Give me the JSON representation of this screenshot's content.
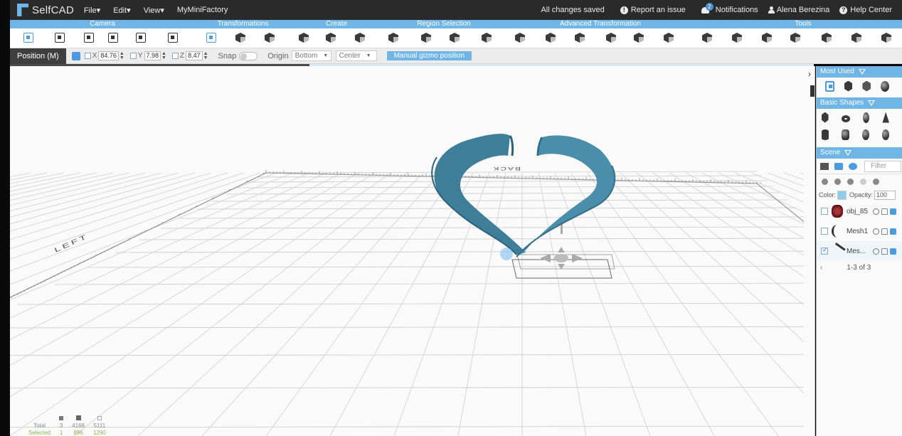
{
  "topbar": {
    "logo_text": "SelfCAD",
    "menus": [
      "File",
      "Edit",
      "View"
    ],
    "menu_caret": "▾",
    "brand_link": "MyMiniFactory",
    "status": "All changes saved",
    "report_issue": "Report an issue",
    "notifications": "Notifications",
    "notification_count": "2",
    "user_name": "Alena Berezina",
    "help": "Help Center"
  },
  "categories": [
    "Camera",
    "Transformations",
    "Create",
    "Region Selection",
    "Advanced Transformation",
    "Tools"
  ],
  "position_bar": {
    "label": "Position (M)",
    "x_label": "X",
    "x_value": "84.76",
    "y_label": "Y",
    "y_value": "7.98",
    "z_label": "Z",
    "z_value": "8.47",
    "snap_label": "Snap",
    "origin_label": "Origin",
    "origin_vertical": "Bottom",
    "origin_horizontal": "Center",
    "manual_gizmo": "Manual gizmo position"
  },
  "viewport": {
    "left_label": "LEFT",
    "back_label": "BACK"
  },
  "stats": {
    "total_label": "Total",
    "total": [
      "3",
      "4168",
      "5111"
    ],
    "selected_label": "Selected",
    "selected": [
      "1",
      "896",
      "1290"
    ]
  },
  "right_panel": {
    "most_used": "Most Used",
    "basic_shapes": "Basic Shapes",
    "scene": "Scene",
    "filter_placeholder": "Filter",
    "color_label": "Color:",
    "opacity_label": "Opacity:",
    "opacity_value": "100",
    "objects": [
      {
        "name": "obj_85",
        "checked": false
      },
      {
        "name": "Mesh1",
        "checked": false
      },
      {
        "name": "Mes...",
        "checked": true
      }
    ],
    "pager": "1-3 of 3"
  },
  "colors": {
    "accent": "#6fb6e6",
    "topbar": "#2a2a2a",
    "model": "#3f7e99",
    "selected_green": "#8fb84f"
  }
}
